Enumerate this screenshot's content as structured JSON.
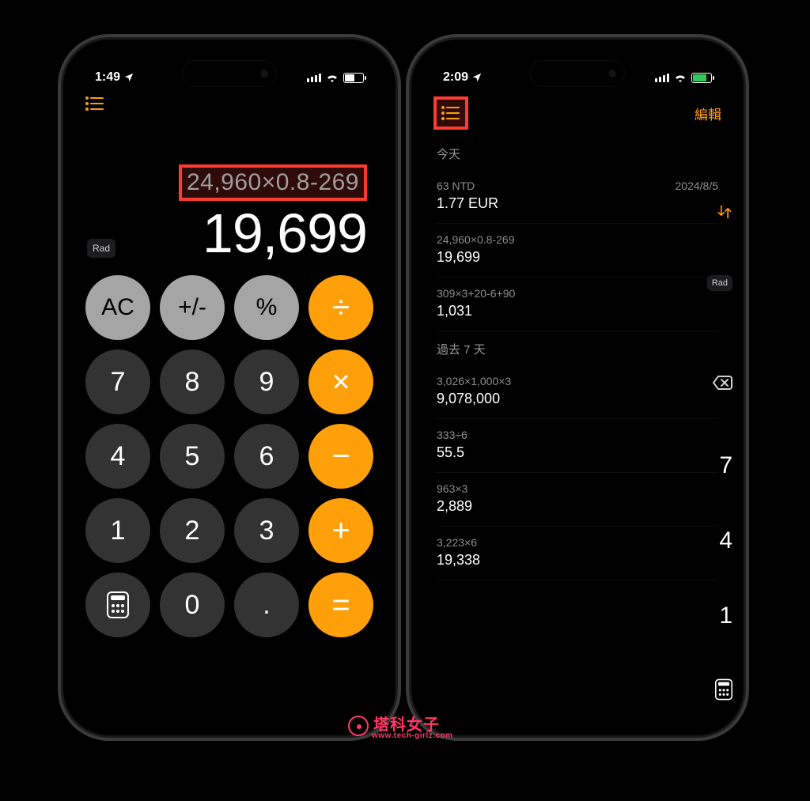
{
  "left": {
    "status": {
      "time": "1:49",
      "location_icon": "location-arrow"
    },
    "rad_label": "Rad",
    "expression": "24,960×0.8-269",
    "result": "19,699",
    "keys": {
      "ac": "AC",
      "plusminus": "+/-",
      "percent": "%",
      "divide": "÷",
      "k7": "7",
      "k8": "8",
      "k9": "9",
      "multiply": "×",
      "k4": "4",
      "k5": "5",
      "k6": "6",
      "minus": "−",
      "k1": "1",
      "k2": "2",
      "k3": "3",
      "plus": "+",
      "calc_mode_icon": "calculator-grid-icon",
      "k0": "0",
      "dot": ".",
      "equals": "="
    }
  },
  "right": {
    "status": {
      "time": "2:09",
      "location_icon": "location-arrow"
    },
    "edit_label": "編輯",
    "sections": [
      {
        "title": "今天",
        "items": [
          {
            "expr": "63 NTD",
            "date": "2024/8/5",
            "result": "1.77 EUR"
          },
          {
            "expr": "24,960×0.8-269",
            "date": "",
            "result": "19,699"
          },
          {
            "expr": "309×3+20-6+90",
            "date": "",
            "result": "1,031"
          }
        ]
      },
      {
        "title": "過去 7 天",
        "items": [
          {
            "expr": "3,026×1,000×3",
            "date": "",
            "result": "9,078,000"
          },
          {
            "expr": "333÷6",
            "date": "",
            "result": "55.5"
          },
          {
            "expr": "963×3",
            "date": "",
            "result": "2,889"
          },
          {
            "expr": "3,223×6",
            "date": "",
            "result": "19,338"
          }
        ]
      }
    ],
    "peek": {
      "swap_icon": "↑↓",
      "rad": "Rad",
      "seven": "7",
      "four": "4",
      "one": "1"
    }
  },
  "watermark": {
    "text": "塔科女子",
    "url": "www.tech-girlz.com"
  }
}
